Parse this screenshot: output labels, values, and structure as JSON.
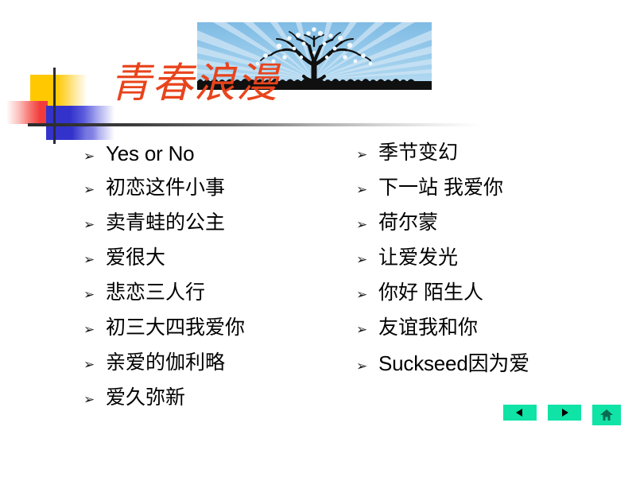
{
  "slide": {
    "title": "青春浪漫",
    "title_color": "#E8441C",
    "background_color": "#FFFFFF",
    "bullet_glyph": "➢"
  },
  "header_image": {
    "name": "blossoming-tree-photo",
    "description": "Silhouette of a blossoming tree on grass against a blue sky with radial sunburst rays",
    "sky_color": "#8FC4E8",
    "ray_color": "#C3DFF2",
    "tree_color": "#111111"
  },
  "decoration": {
    "yellow_color": "#FFC800",
    "red_color": "#F23B3B",
    "blue_color": "#3333CC",
    "line_color": "#2B2B2B"
  },
  "columns": {
    "left": [
      {
        "text": "Yes or No",
        "script": "latin"
      },
      {
        "text": "初恋这件小事",
        "script": "han"
      },
      {
        "text": "卖青蛙的公主",
        "script": "han"
      },
      {
        "text": "爱很大",
        "script": "han"
      },
      {
        "text": "悲恋三人行",
        "script": "han"
      },
      {
        "text": "初三大四我爱你",
        "script": "han"
      },
      {
        "text": "亲爱的伽利略",
        "script": "han"
      },
      {
        "text": "爱久弥新",
        "script": "han"
      }
    ],
    "right": [
      {
        "text": "季节变幻",
        "script": "han"
      },
      {
        "text": "下一站 我爱你",
        "script": "han"
      },
      {
        "text": "荷尔蒙",
        "script": "han"
      },
      {
        "text": "让爱发光",
        "script": "han"
      },
      {
        "text": "你好 陌生人",
        "script": "han"
      },
      {
        "text": "友谊我和你",
        "script": "han"
      },
      {
        "text": "Suckseed因为爱",
        "script": "latin"
      }
    ]
  },
  "nav": {
    "color": "#0FE3A6",
    "buttons": [
      {
        "name": "previous-slide-button",
        "icon": "triangle-left-icon",
        "label": "Previous"
      },
      {
        "name": "next-slide-button",
        "icon": "triangle-right-icon",
        "label": "Next"
      },
      {
        "name": "home-slide-button",
        "icon": "home-icon",
        "label": "Home"
      }
    ]
  }
}
